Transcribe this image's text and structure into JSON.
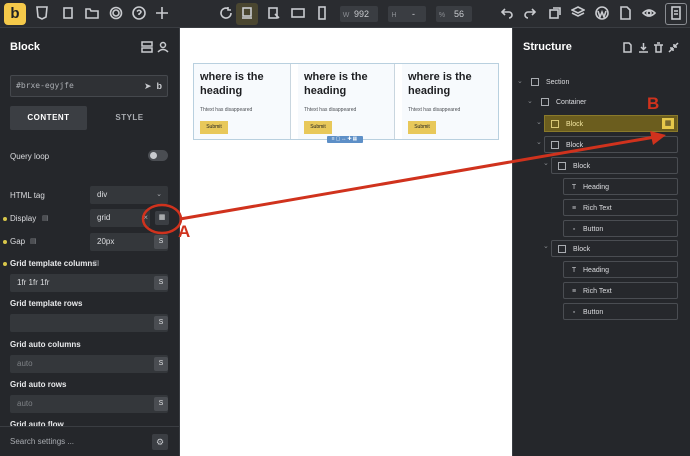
{
  "topbar": {
    "logo": "b",
    "width_label": "W",
    "width_value": "992",
    "height_label": "H",
    "height_value": "-",
    "zoom_label": "%",
    "zoom_value": "56"
  },
  "left_panel": {
    "title": "Block",
    "element_id": "#brxe-egyjfe",
    "tabs": [
      "CONTENT",
      "STYLE"
    ],
    "query_loop_label": "Query loop",
    "html_tag": {
      "label": "HTML tag",
      "value": "div"
    },
    "display": {
      "label": "Display",
      "value": "grid"
    },
    "gap": {
      "label": "Gap",
      "value": "20px"
    },
    "grid_template_columns": {
      "label": "Grid template columns",
      "value": "1fr 1fr 1fr"
    },
    "grid_template_rows": {
      "label": "Grid template rows",
      "value": ""
    },
    "grid_auto_columns": {
      "label": "Grid auto columns",
      "placeholder": "auto"
    },
    "grid_auto_rows": {
      "label": "Grid auto rows",
      "placeholder": "auto"
    },
    "grid_auto_flow": {
      "label": "Grid auto flow"
    },
    "search_placeholder": "Search settings ..."
  },
  "canvas": {
    "cards": [
      {
        "heading": "where is the heading",
        "text": "Thtext has disappeared",
        "button": "Submit"
      },
      {
        "heading": "where is the heading",
        "text": "Thtext has disappeared",
        "button": "Submit"
      },
      {
        "heading": "where is the heading",
        "text": "Thtext has disappeared",
        "button": "Submit"
      }
    ]
  },
  "structure": {
    "title": "Structure",
    "items": [
      {
        "label": "Section",
        "icon": "section-icon"
      },
      {
        "label": "Container",
        "icon": "container-icon"
      },
      {
        "label": "Block",
        "icon": "block-icon",
        "selected": true
      },
      {
        "label": "Block",
        "icon": "block-icon"
      },
      {
        "label": "Block",
        "icon": "block-icon"
      },
      {
        "label": "Heading",
        "icon": "heading-icon"
      },
      {
        "label": "Rich Text",
        "icon": "rich-text-icon"
      },
      {
        "label": "Button",
        "icon": "button-icon"
      },
      {
        "label": "Block",
        "icon": "block-icon"
      },
      {
        "label": "Heading",
        "icon": "heading-icon"
      },
      {
        "label": "Rich Text",
        "icon": "rich-text-icon"
      },
      {
        "label": "Button",
        "icon": "button-icon"
      }
    ]
  },
  "annotations": {
    "a": "A",
    "b": "B",
    "color": "#d0321d"
  },
  "colors": {
    "accent": "#f5c94a",
    "selected": "#6b5d1e",
    "annotation": "#d0321d"
  }
}
